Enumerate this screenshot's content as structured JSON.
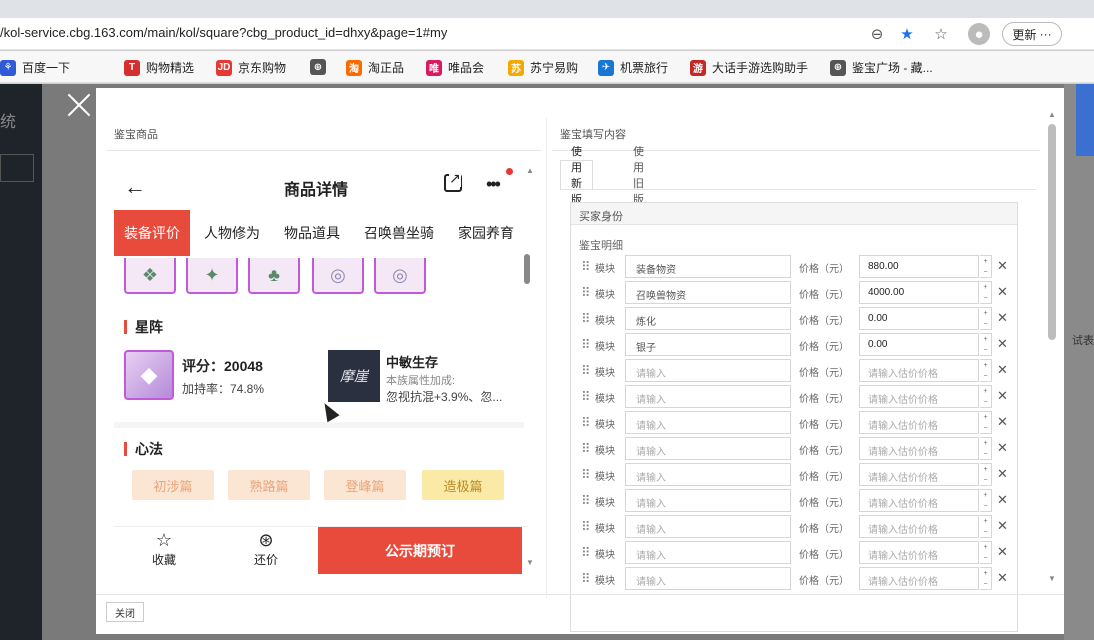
{
  "browser": {
    "url": "/kol-service.cbg.163.com/main/kol/square?cbg_product_id=dhxy&page=1#my",
    "update_label": "更新",
    "bookmarks": [
      {
        "label": "百度一下",
        "icon": "baidu-icon",
        "color": "#2f5cd6"
      },
      {
        "label": "购物精选",
        "icon": "shop-icon",
        "color": "#d32f2f"
      },
      {
        "label": "京东购物",
        "icon": "jd-icon",
        "color": "#e53935"
      },
      {
        "label": "",
        "icon": "globe-icon",
        "color": "#555555"
      },
      {
        "label": "淘正品",
        "icon": "taobao-icon",
        "color": "#ff6a00"
      },
      {
        "label": "唯品会",
        "icon": "vip-icon",
        "color": "#d81b60"
      },
      {
        "label": "苏宁易购",
        "icon": "suning-icon",
        "color": "#f6a800"
      },
      {
        "label": "机票旅行",
        "icon": "flight-icon",
        "color": "#1976d2"
      },
      {
        "label": "大话手游选购助手",
        "icon": "game-icon",
        "color": "#c62828"
      },
      {
        "label": "鉴宝广场 - 藏...",
        "icon": "globe-icon",
        "color": "#555555"
      }
    ]
  },
  "background": {
    "left_title": "统",
    "right_text": "试表"
  },
  "modal": {
    "left_title": "鉴宝商品",
    "right_title": "鉴宝填写内容",
    "close_label": "关闭"
  },
  "product": {
    "title": "商品详情",
    "tabs": [
      "装备评价",
      "人物修为",
      "物品道具",
      "召唤兽坐骑",
      "家园养育"
    ],
    "star_section": {
      "title": "星阵",
      "score": "评分：20048",
      "rate": "加持率：74.8%",
      "formation_name": "中敏生存",
      "formation_sub": "本族属性加成:",
      "formation_val": "忽视抗混+3.9%、忽...",
      "formation_img_text": "摩崖"
    },
    "xinfa_section": {
      "title": "心法",
      "tags": [
        "初涉篇",
        "熟路篇",
        "登峰篇",
        "造极篇"
      ]
    },
    "footer": {
      "fav": "收藏",
      "bargain": "还价",
      "buy": "公示期预订"
    }
  },
  "form": {
    "mode_tabs": [
      "使用新版",
      "使用旧版"
    ],
    "legend": "买家身份",
    "subtitle": "鉴宝明细",
    "module_label": "模块",
    "price_label": "价格（元）",
    "rows": [
      {
        "name": "装备物资",
        "price": "880.00",
        "filled": true
      },
      {
        "name": "召唤兽物资",
        "price": "4000.00",
        "filled": true
      },
      {
        "name": "炼化",
        "price": "0.00",
        "filled": true
      },
      {
        "name": "银子",
        "price": "0.00",
        "filled": true
      },
      {
        "name": "请输入",
        "price": "请输入估价价格",
        "filled": false
      },
      {
        "name": "请输入",
        "price": "请输入估价价格",
        "filled": false
      },
      {
        "name": "请输入",
        "price": "请输入估价价格",
        "filled": false
      },
      {
        "name": "请输入",
        "price": "请输入估价价格",
        "filled": false
      },
      {
        "name": "请输入",
        "price": "请输入估价价格",
        "filled": false
      },
      {
        "name": "请输入",
        "price": "请输入估价价格",
        "filled": false
      },
      {
        "name": "请输入",
        "price": "请输入估价价格",
        "filled": false
      },
      {
        "name": "请输入",
        "price": "请输入估价价格",
        "filled": false
      },
      {
        "name": "请输入",
        "price": "请输入估价价格",
        "filled": false
      }
    ]
  },
  "colors": {
    "accent": "#e84a3c",
    "purple_frame": "#c15ad8"
  }
}
